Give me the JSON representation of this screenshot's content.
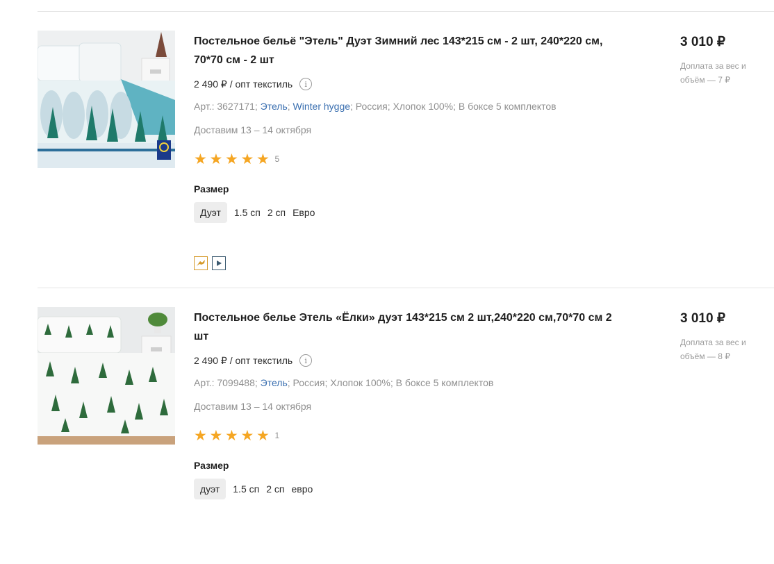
{
  "products": [
    {
      "title": "Постельное бельё \"Этель\" Дуэт Зимний лес 143*215 см - 2 шт, 240*220 см, 70*70 см - 2 шт",
      "wholesale_price": "2 490 ₽ / опт текстиль",
      "article": "Арт.: 3627171;",
      "brand": "Этель",
      "collection": "Winter hygge",
      "meta_rest": "; Россия; Хлопок 100%; В боксе 5 комплектов",
      "delivery": "Доставим 13 – 14 октября",
      "rating": 5,
      "rating_count": "5",
      "size_label": "Размер",
      "sizes": [
        "Дуэт",
        "1.5 сп",
        "2 сп",
        "Евро"
      ],
      "selected_size": "Дуэт",
      "badges": [
        "promo-icon",
        "video-play-icon"
      ],
      "price": "3 010 ₽",
      "surcharge": "Доплата за вес и объём — 7 ₽"
    },
    {
      "title": "Постельное белье Этель «Ёлки» дуэт 143*215 см 2 шт,240*220 см,70*70 см 2 шт",
      "wholesale_price": "2 490 ₽ / опт текстиль",
      "article": "Арт.: 7099488;",
      "brand": "Этель",
      "meta_rest": "; Россия; Хлопок 100%; В боксе 5 комплектов",
      "delivery": "Доставим 13 – 14 октября",
      "rating": 5,
      "rating_count": "1",
      "size_label": "Размер",
      "sizes": [
        "дуэт",
        "1.5 сп",
        "2 сп",
        "евро"
      ],
      "selected_size": "дуэт",
      "price": "3 010 ₽",
      "surcharge": "Доплата за вес и объём — 8 ₽"
    }
  ],
  "colors": {
    "accent_star": "#f5a623",
    "link": "#3a6fb0",
    "muted_text": "#8f8f8f"
  }
}
